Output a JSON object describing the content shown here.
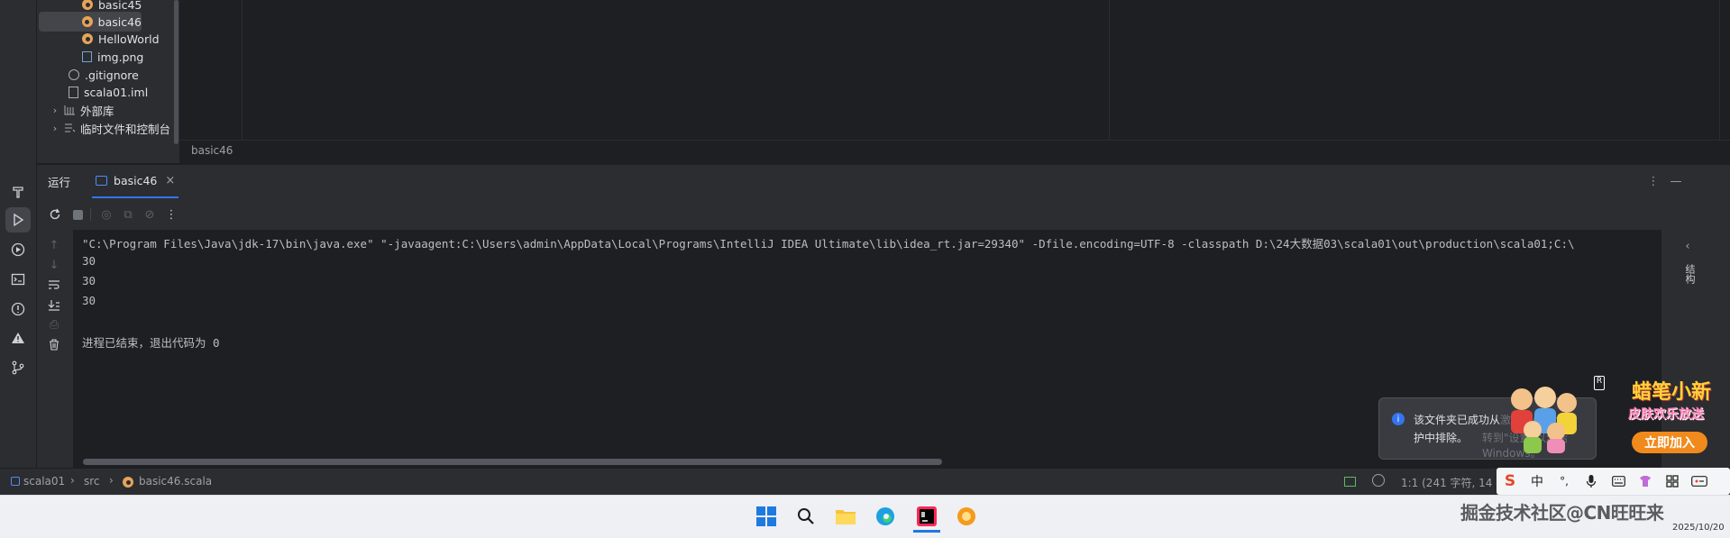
{
  "project_tree": {
    "items": [
      {
        "label": "basic45",
        "icon": "scala-object-icon"
      },
      {
        "label": "basic46",
        "icon": "scala-object-icon"
      },
      {
        "label": "HelloWorld",
        "icon": "scala-object-icon"
      },
      {
        "label": "img.png",
        "icon": "image-file-icon"
      },
      {
        "label": ".gitignore",
        "icon": "ignore-file-icon"
      },
      {
        "label": "scala01.iml",
        "icon": "module-file-icon"
      },
      {
        "label": "外部库",
        "icon": "library-icon"
      },
      {
        "label": "临时文件和控制台",
        "icon": "scratch-icon"
      }
    ]
  },
  "editor": {
    "breadcrumb": "basic46"
  },
  "run_panel": {
    "title": "运行",
    "tab_label": "basic46",
    "console_lines": [
      "\"C:\\Program Files\\Java\\jdk-17\\bin\\java.exe\" \"-javaagent:C:\\Users\\admin\\AppData\\Local\\Programs\\IntelliJ IDEA Ultimate\\lib\\idea_rt.jar=29340\" -Dfile.encoding=UTF-8 -classpath D:\\24大数据03\\scala01\\out\\production\\scala01;C:\\",
      "30",
      "30",
      "30",
      "",
      "进程已结束，退出代码为 0"
    ],
    "right_label": "结构"
  },
  "statusbar": {
    "crumb_project": "scala01",
    "crumb_src": "src",
    "crumb_file": "basic46.scala",
    "position": "1:1 (241 字符, 14 行"
  },
  "notification": {
    "line1": "该文件夹已成功从",
    "line2": "护中排除。",
    "faded1": "激活 Window",
    "faded2": "转到\"设置\"以激活 Windows。"
  },
  "ad": {
    "title": "蜡笔小新",
    "subtitle": "皮肤欢乐放送",
    "button": "立即加入"
  },
  "ime": {
    "mode": "中",
    "punct": "°,"
  },
  "taskbar": {
    "watermark": "掘金技术社区@CN旺旺来",
    "date": "2025/10/20"
  },
  "colors": {
    "accent": "#3574f0",
    "scala": "#e5a45a",
    "panel": "#2b2d30",
    "editor": "#1e1f22"
  }
}
